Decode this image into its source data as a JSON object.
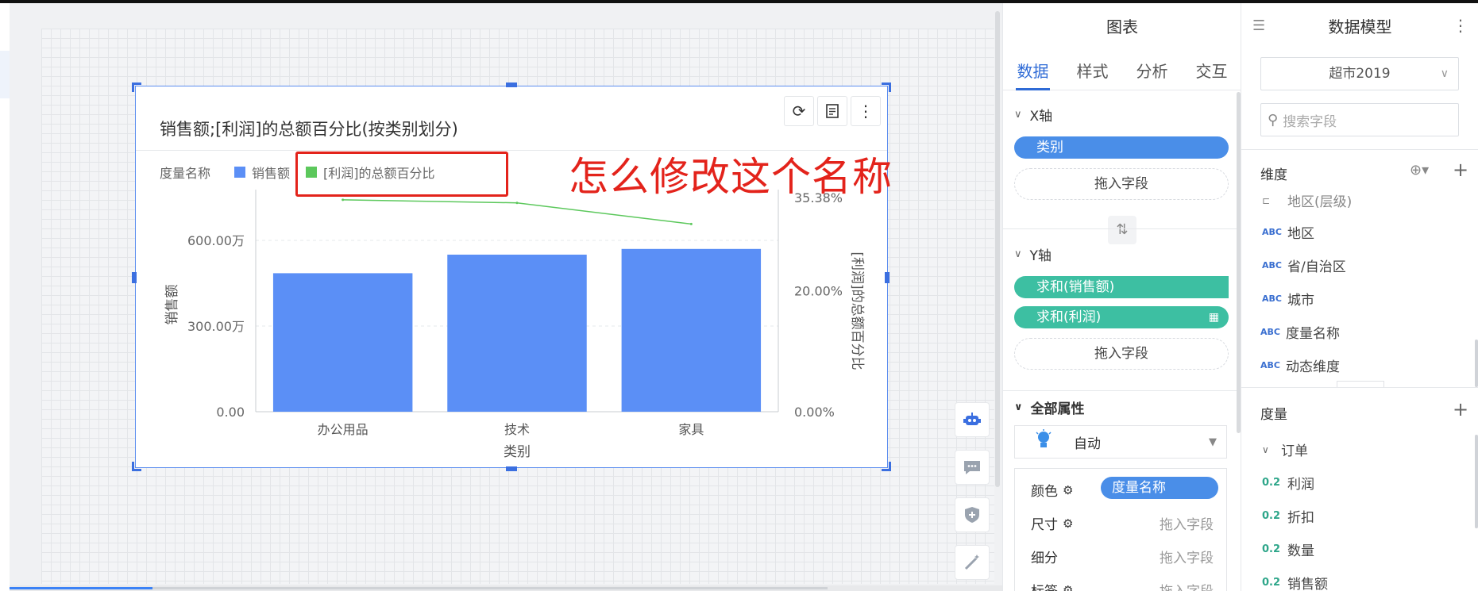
{
  "chart_widget": {
    "title": "销售额;[利润]的总额百分比(按类别划分)",
    "legend_label": "度量名称",
    "tools": [
      "refresh-icon",
      "note-icon",
      "more-icon"
    ]
  },
  "annotation": {
    "text": "怎么修改这个名称",
    "color": "#e3231b"
  },
  "chart_data": {
    "type": "bar+line",
    "categories": [
      "办公用品",
      "技术",
      "家具"
    ],
    "xlabel": "类别",
    "ylabel": "销售额",
    "y2label": "[利润]的总额百分比",
    "yticks": [
      "0.00",
      "300.00万",
      "600.00万"
    ],
    "y2ticks": [
      "0.00%",
      "20.00%",
      "35.38%"
    ],
    "ylim": [
      0,
      7500000
    ],
    "y2lim": [
      0,
      0.3538
    ],
    "series": [
      {
        "name": "销售额",
        "type": "bar",
        "color": "#5b8ff6",
        "values": [
          4850000,
          5500000,
          5700000
        ]
      },
      {
        "name": "[利润]的总额百分比",
        "type": "line",
        "color": "#5cc85c",
        "values": [
          0.35,
          0.345,
          0.31
        ]
      }
    ]
  },
  "chart_panel": {
    "title": "图表",
    "tabs": [
      "数据",
      "样式",
      "分析",
      "交互"
    ],
    "x_axis": {
      "label": "X轴",
      "field": "类别",
      "drop_hint": "拖入字段"
    },
    "y_axis": {
      "label": "Y轴",
      "fields": [
        "求和(销售额)",
        "求和(利润)"
      ],
      "drop_hint": "拖入字段"
    },
    "all_props": {
      "label": "全部属性",
      "mode": "自动",
      "rows": [
        {
          "name": "颜色",
          "value": "度量名称"
        },
        {
          "name": "尺寸",
          "value": "拖入字段"
        },
        {
          "name": "细分",
          "value": "拖入字段"
        },
        {
          "name": "标签",
          "value": "拖入字段"
        }
      ]
    }
  },
  "model_panel": {
    "title": "数据模型",
    "dataset": "超市2019",
    "search_placeholder": "搜索字段",
    "dimensions_label": "维度",
    "dimensions": [
      {
        "type": "ABC",
        "name": "地区(层级)"
      },
      {
        "type": "ABC",
        "name": "地区"
      },
      {
        "type": "ABC",
        "name": "省/自治区"
      },
      {
        "type": "ABC",
        "name": "城市"
      },
      {
        "type": "ABC",
        "name": "度量名称"
      },
      {
        "type": "ABC",
        "name": "动态维度"
      }
    ],
    "measures_label": "度量",
    "measure_group": "订单",
    "measures": [
      {
        "type": "0.2",
        "name": "利润"
      },
      {
        "type": "0.2",
        "name": "折扣"
      },
      {
        "type": "0.2",
        "name": "数量"
      },
      {
        "type": "0.2",
        "name": "销售额"
      }
    ]
  }
}
